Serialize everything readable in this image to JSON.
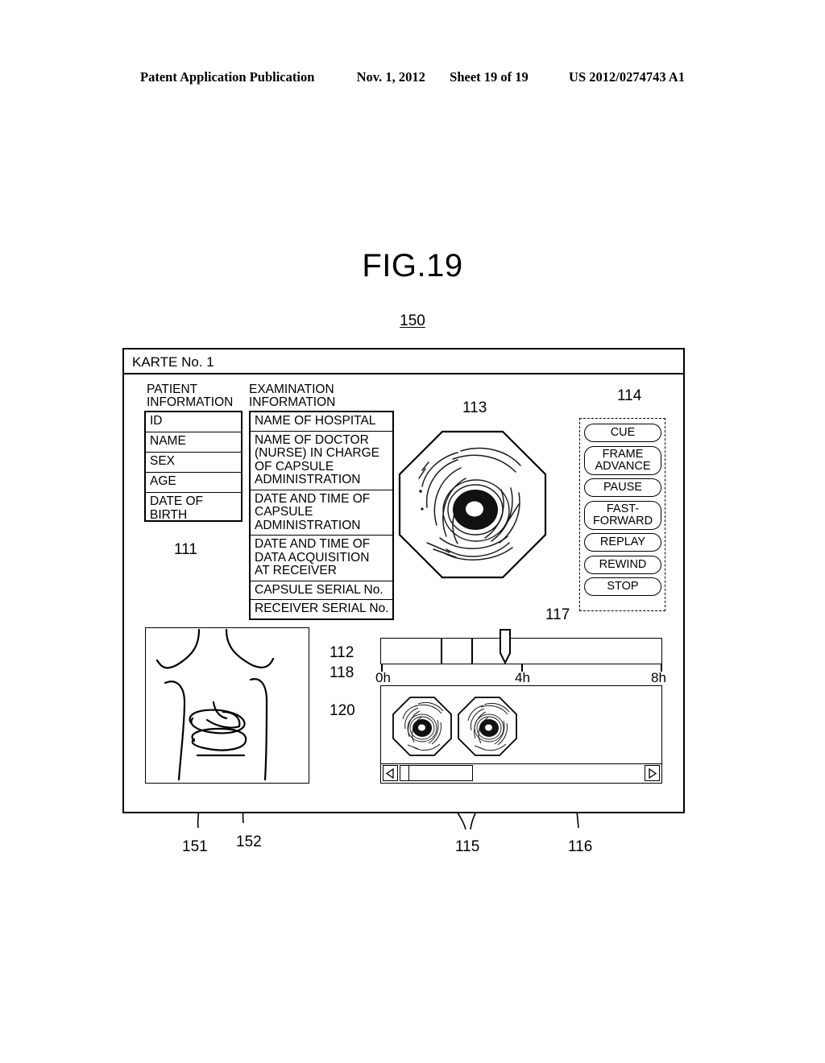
{
  "page_header": {
    "publication": "Patent Application Publication",
    "date": "Nov. 1, 2012",
    "sheet": "Sheet 19 of 19",
    "number": "US 2012/0274743 A1"
  },
  "figure": {
    "title": "FIG.19",
    "ref_main": "150"
  },
  "window": {
    "titlebar": "KARTE No. 1"
  },
  "patient_info": {
    "heading": "PATIENT\nINFORMATION",
    "ref": "111",
    "rows": [
      "ID",
      "NAME",
      "SEX",
      "AGE",
      "DATE OF\nBIRTH"
    ]
  },
  "exam_info": {
    "heading": "EXAMINATION\nINFORMATION",
    "ref": "112",
    "rows": [
      "NAME OF HOSPITAL",
      "NAME OF DOCTOR\n(NURSE) IN CHARGE\nOF CAPSULE\nADMINISTRATION",
      "DATE AND TIME OF\nCAPSULE\nADMINISTRATION",
      "DATE AND TIME OF\nDATA ACQUISITION\nAT RECEIVER",
      "CAPSULE SERIAL No.",
      "RECEIVER SERIAL No."
    ]
  },
  "main_image": {
    "ref": "113",
    "icon": "capsule-endoscope-image"
  },
  "controls": {
    "ref": "114",
    "buttons": [
      "CUE",
      "FRAME\nADVANCE",
      "PAUSE",
      "FAST-\nFORWARD",
      "REPLAY",
      "REWIND",
      "STOP"
    ]
  },
  "body_diagram": {
    "ref_frame": "118",
    "ref_path": "120",
    "ref_organ": "151",
    "ref_trace": "152",
    "icon": "human-torso-outline"
  },
  "timeline": {
    "ref": "117",
    "labels": [
      "0h",
      "4h",
      "8h"
    ],
    "cursor_position": "4h"
  },
  "thumbnails": {
    "ref_images": "115",
    "ref_panel": "116",
    "count": 2,
    "icon": "capsule-endoscope-thumbnail"
  },
  "scrollbar": {
    "left_arrow": "left-arrow-icon",
    "right_arrow": "right-arrow-icon",
    "thumb": "scrollbar-thumb"
  }
}
